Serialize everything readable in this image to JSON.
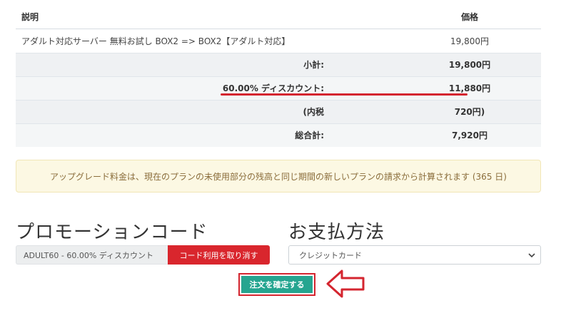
{
  "table": {
    "header_description": "説明",
    "header_price": "価格",
    "item": {
      "description": "アダルト対応サーバー 無料お試し BOX2 => BOX2【アダルト対応】",
      "price": "19,800円"
    },
    "summary": [
      {
        "label": "小計:",
        "value": "19,800円"
      },
      {
        "label": "60.00% ディスカウント:",
        "value": "11,880円"
      },
      {
        "label": "(内税",
        "value": "720円)"
      },
      {
        "label": "総合計:",
        "value": "7,920円"
      }
    ]
  },
  "notice": "アップグレード料金は、現在のプランの未使用部分の残高と同じ期間の新しいプランの請求から計算されます (365 日)",
  "promo": {
    "title": "プロモーションコード",
    "applied_code": "ADULT60 - 60.00% ディスカウント",
    "remove_label": "コード利用を取り消す"
  },
  "payment": {
    "title": "お支払方法",
    "selected": "クレジットカード"
  },
  "confirm_label": "注文を確定する",
  "colors": {
    "highlight_red": "#d4252f",
    "confirm_green": "#25a590",
    "remove_red": "#d9262d",
    "notice_bg": "#fcf8e3"
  },
  "icons": {
    "select": "chevron-down-icon",
    "pointer": "arrow-left-icon"
  }
}
